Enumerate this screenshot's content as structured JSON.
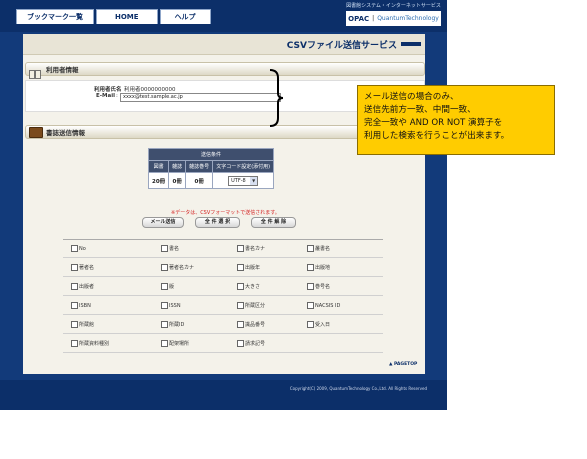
{
  "tabs": {
    "bookmark": "ブックマーク一覧",
    "home": "HOME",
    "help": "ヘルプ"
  },
  "logo": {
    "small_caption": "図書館システム・インターネットサービス",
    "opac": "OPAC",
    "separator": "|",
    "brand": "QuantumTechnology"
  },
  "service_title": "CSVファイル送信サービス",
  "user_section": {
    "title": "利用者情報",
    "name_label": "利用者氏名",
    "name_value": "利用者0000000000",
    "email_label": "E-Mail",
    "email_value": "xxxx@test.sample.ac.jp"
  },
  "book_section": {
    "title": "書誌送信情報"
  },
  "send_table": {
    "header_top": "送信条件",
    "columns": [
      "図書",
      "雑誌",
      "雑誌巻号",
      "文字コード設定(添付用)"
    ],
    "values": [
      "20冊",
      "0冊",
      "0冊"
    ],
    "encoding_selected": "UTF-8"
  },
  "note": "※データは、CSVフォーマットで送信されます。",
  "buttons": {
    "send": "メール送信",
    "select_all": "全 件 選 択",
    "deselect_all": "全 件 解 除"
  },
  "fields": [
    [
      "No",
      "書名",
      "書名カナ",
      "叢書名"
    ],
    [
      "著者名",
      "著者名カナ",
      "出版年",
      "出版地"
    ],
    [
      "出版者",
      "版",
      "大きさ",
      "巻号名"
    ],
    [
      "ISBN",
      "ISSN",
      "所蔵区分",
      "NACSIS ID"
    ],
    [
      "所蔵館",
      "所蔵ID",
      "識品番号",
      "受入日"
    ],
    [
      "所蔵資料種別",
      "配架場所",
      "請求記号",
      ""
    ]
  ],
  "pagetop": "▲ PAGETOP",
  "footer": {
    "copyright": "Copyright(C) 2009, QuantumTechnology Co.,Ltd. All Rights Reserved"
  },
  "callout": {
    "lines": [
      "メール送信の場合のみ、",
      "送信先前方一致、中間一致、",
      "完全一致や AND OR NOT 演算子を",
      "利用した検索を行うことが出来ます。"
    ]
  },
  "colors": {
    "navy": "#0c2f69",
    "callout_yellow": "#ffcc00",
    "note_red": "#d42020"
  }
}
